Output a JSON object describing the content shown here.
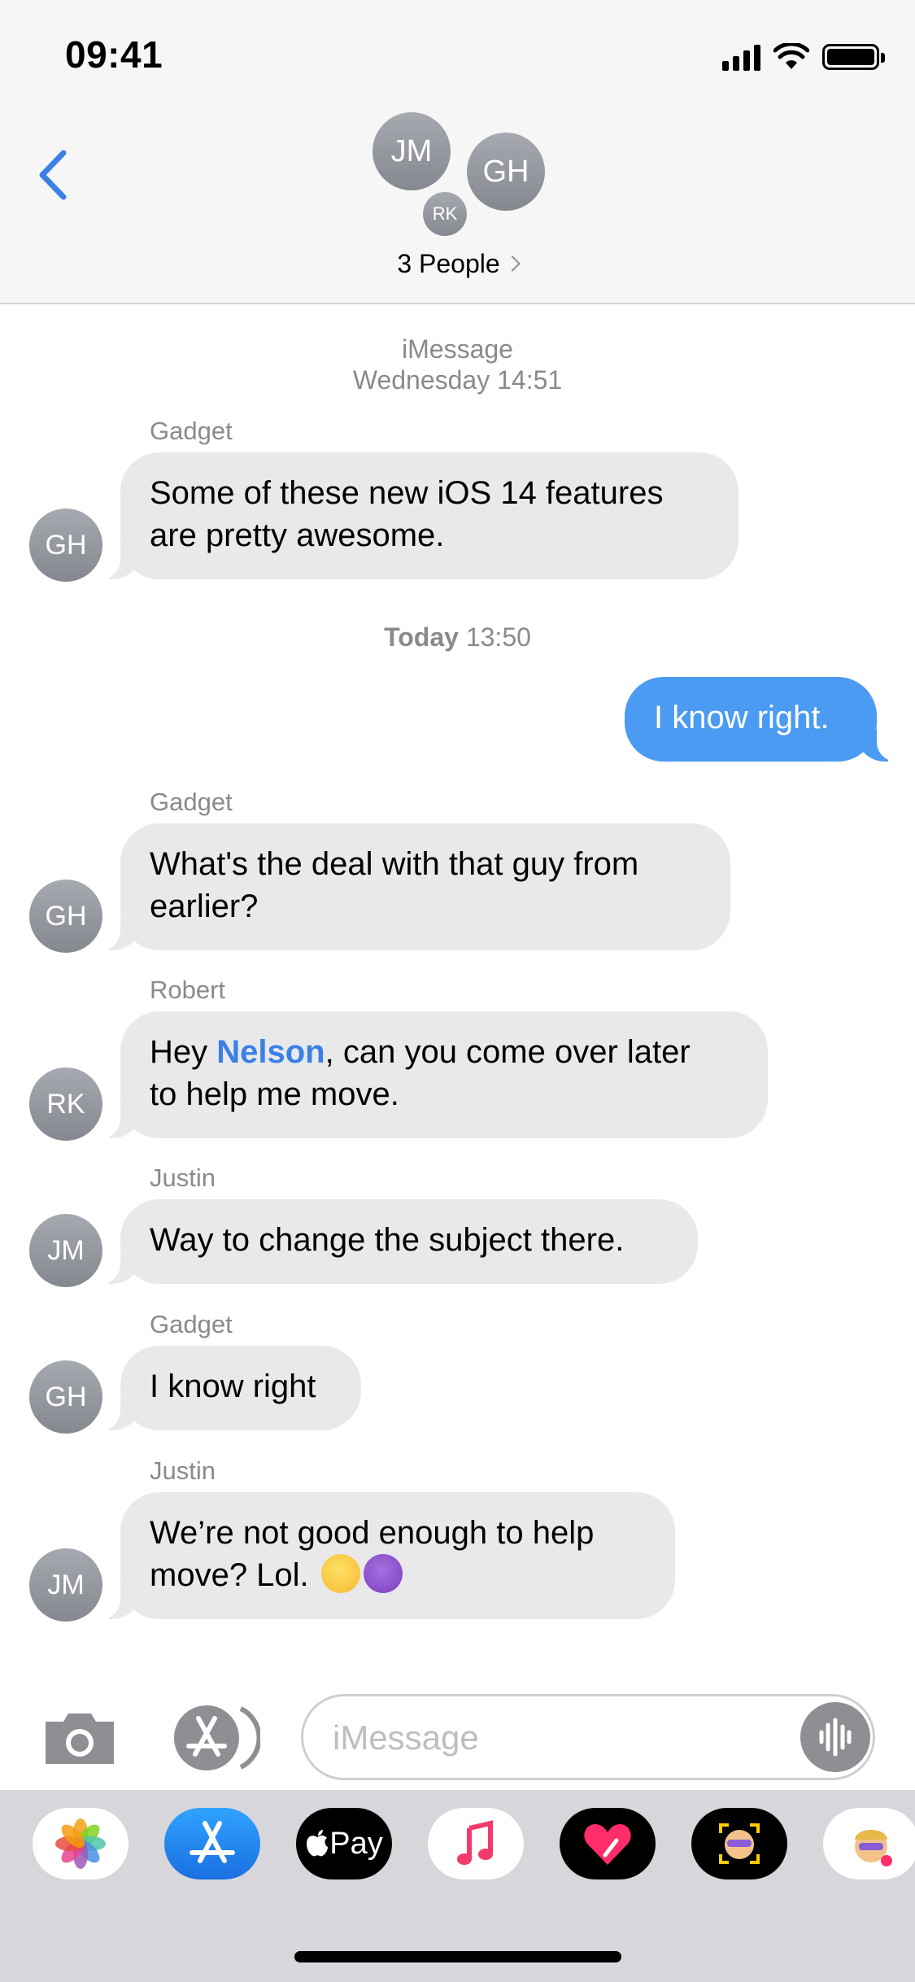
{
  "status_bar": {
    "time": "09:41"
  },
  "header": {
    "avatars": {
      "jm": "JM",
      "gh": "GH",
      "rk": "RK"
    },
    "group_title": "3 People"
  },
  "conversation": {
    "service_label": "iMessage",
    "stamp1_day": "Wednesday",
    "stamp1_time": "14:51",
    "stamp2_day": "Today",
    "stamp2_time": "13:50",
    "messages": [
      {
        "sender": "Gadget",
        "initials": "GH",
        "lines": [
          "Some of these new iOS 14 features",
          "are pretty awesome."
        ]
      },
      {
        "outgoing": true,
        "text": "I know right."
      },
      {
        "sender": "Gadget",
        "initials": "GH",
        "lines": [
          "What's the deal with that guy from",
          "earlier?"
        ]
      },
      {
        "sender": "Robert",
        "initials": "RK",
        "pre": "Hey ",
        "mention": "Nelson",
        "post": ", can you come over later",
        "line2": "to help me move."
      },
      {
        "sender": "Justin",
        "initials": "JM",
        "text": "Way to change the subject there."
      },
      {
        "sender": "Gadget",
        "initials": "GH",
        "text": "I know right"
      },
      {
        "sender": "Justin",
        "initials": "JM",
        "line1": "We’re not good enough to help",
        "line2": "move? Lol."
      }
    ]
  },
  "input_bar": {
    "placeholder": "iMessage"
  },
  "apps": {
    "apple_pay_label": "Pay",
    "icons": [
      "photos-icon",
      "app-store-icon",
      "apple-pay-icon",
      "music-icon",
      "digital-touch-icon",
      "memoji-icon",
      "memoji-stickers-icon"
    ]
  },
  "colors": {
    "accent": "#3a80e5",
    "outgoing_bubble": "#4a9bf1",
    "incoming_bubble": "#e9e9eb"
  }
}
